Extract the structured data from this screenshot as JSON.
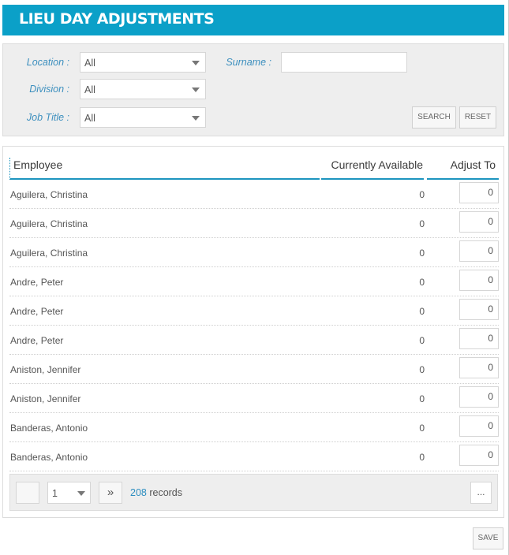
{
  "header": {
    "title": "LIEU DAY ADJUSTMENTS"
  },
  "filters": {
    "location": {
      "label": "Location :",
      "value": "All"
    },
    "division": {
      "label": "Division :",
      "value": "All"
    },
    "job_title": {
      "label": "Job Title :",
      "value": "All"
    },
    "surname": {
      "label": "Surname :",
      "value": "",
      "placeholder": ""
    },
    "search_label": "SEARCH",
    "reset_label": "RESET"
  },
  "table": {
    "columns": {
      "employee": "Employee",
      "available": "Currently Available",
      "adjust": "Adjust To"
    },
    "rows": [
      {
        "employee": "Aguilera, Christina",
        "available": "0",
        "adjust": "0"
      },
      {
        "employee": "Aguilera, Christina",
        "available": "0",
        "adjust": "0"
      },
      {
        "employee": "Aguilera, Christina",
        "available": "0",
        "adjust": "0"
      },
      {
        "employee": "Andre, Peter",
        "available": "0",
        "adjust": "0"
      },
      {
        "employee": "Andre, Peter",
        "available": "0",
        "adjust": "0"
      },
      {
        "employee": "Andre, Peter",
        "available": "0",
        "adjust": "0"
      },
      {
        "employee": "Aniston, Jennifer",
        "available": "0",
        "adjust": "0"
      },
      {
        "employee": "Aniston, Jennifer",
        "available": "0",
        "adjust": "0"
      },
      {
        "employee": "Banderas, Antonio",
        "available": "0",
        "adjust": "0"
      },
      {
        "employee": "Banderas, Antonio",
        "available": "0",
        "adjust": "0"
      }
    ]
  },
  "pager": {
    "page": "1",
    "next_glyph": "»",
    "record_count": "208",
    "records_label": " records",
    "more_label": "..."
  },
  "footer": {
    "save_label": "SAVE"
  }
}
